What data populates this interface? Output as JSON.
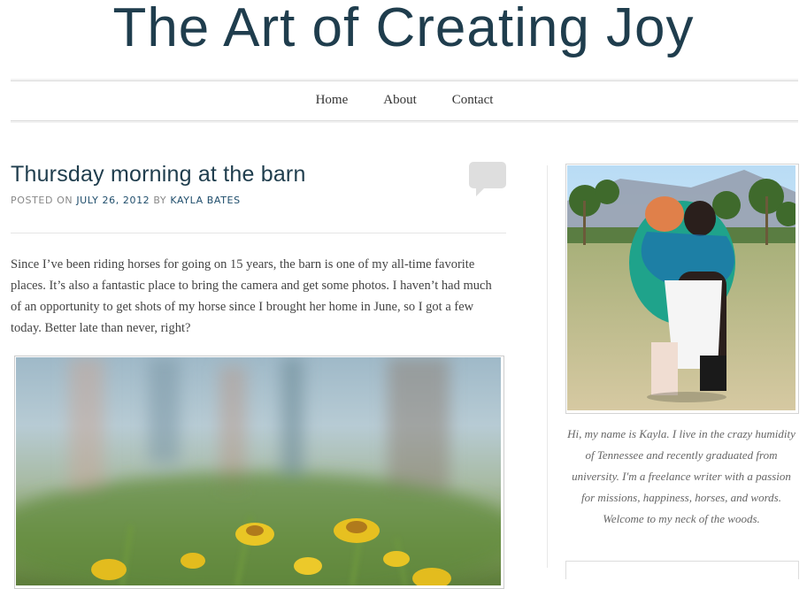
{
  "site": {
    "title": "The Art of Creating Joy"
  },
  "nav": {
    "items": [
      {
        "label": "Home"
      },
      {
        "label": "About"
      },
      {
        "label": "Contact"
      }
    ]
  },
  "post": {
    "title": "Thursday morning at the barn",
    "meta_posted_on": "Posted on",
    "meta_date": "July 26, 2012",
    "meta_by": "by",
    "meta_author": "Kayla Bates",
    "body": "Since I’ve been riding horses for going on 15 years, the barn is one of my all-time favorite places. It’s also a fantastic place to bring the camera and get some photos. I haven’t had much of an opportunity to get shots of my horse since I brought her home in June, so I got a few today. Better late than never, right?"
  },
  "sidebar": {
    "bio": "Hi, my name is Kayla. I live in the crazy humidity of Tennessee and recently graduated from university. I'm a freelance writer with a passion for missions, happiness, horses, and words. Welcome to my neck of the woods."
  },
  "colors": {
    "title": "#1f3d4d",
    "link": "#1f4d6b",
    "bubble": "#dedede"
  },
  "icons": {
    "comment": "comment-bubble-icon"
  }
}
